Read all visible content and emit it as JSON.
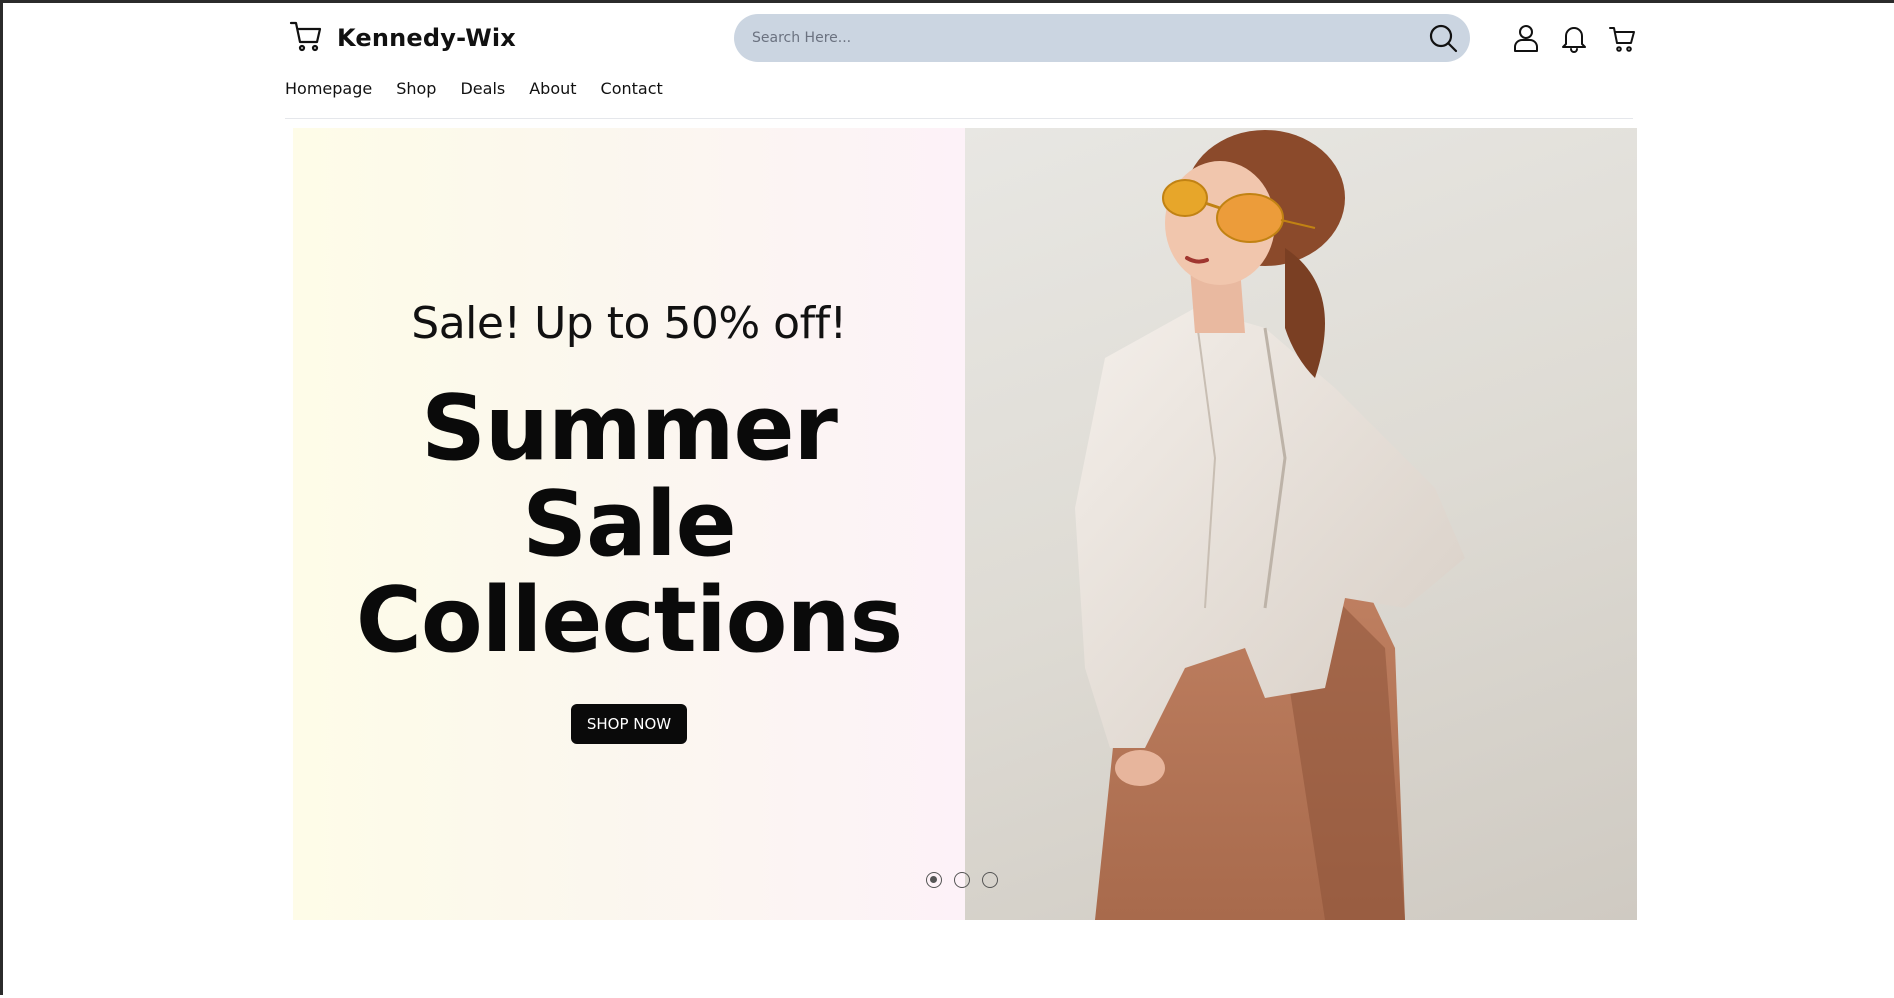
{
  "header": {
    "brand": "Kennedy-Wix",
    "search_placeholder": "Search Here...",
    "icons": [
      "cart-icon",
      "search-icon",
      "user-icon",
      "bell-icon",
      "cart-icon"
    ]
  },
  "nav": {
    "items": [
      {
        "label": "Homepage"
      },
      {
        "label": "Shop"
      },
      {
        "label": "Deals"
      },
      {
        "label": "About"
      },
      {
        "label": "Contact"
      }
    ]
  },
  "hero": {
    "kicker": "Sale! Up to 50% off!",
    "headline": [
      "Summer",
      "Sale",
      "Collections"
    ],
    "cta_label": "SHOP NOW",
    "slides_total": 3,
    "active_slide": 1
  },
  "colors": {
    "search_bg": "#cbd5e1",
    "cta_bg": "#0a0a0a",
    "hero_gradient_start": "#fefce8",
    "hero_gradient_end": "#fdf2f8"
  }
}
